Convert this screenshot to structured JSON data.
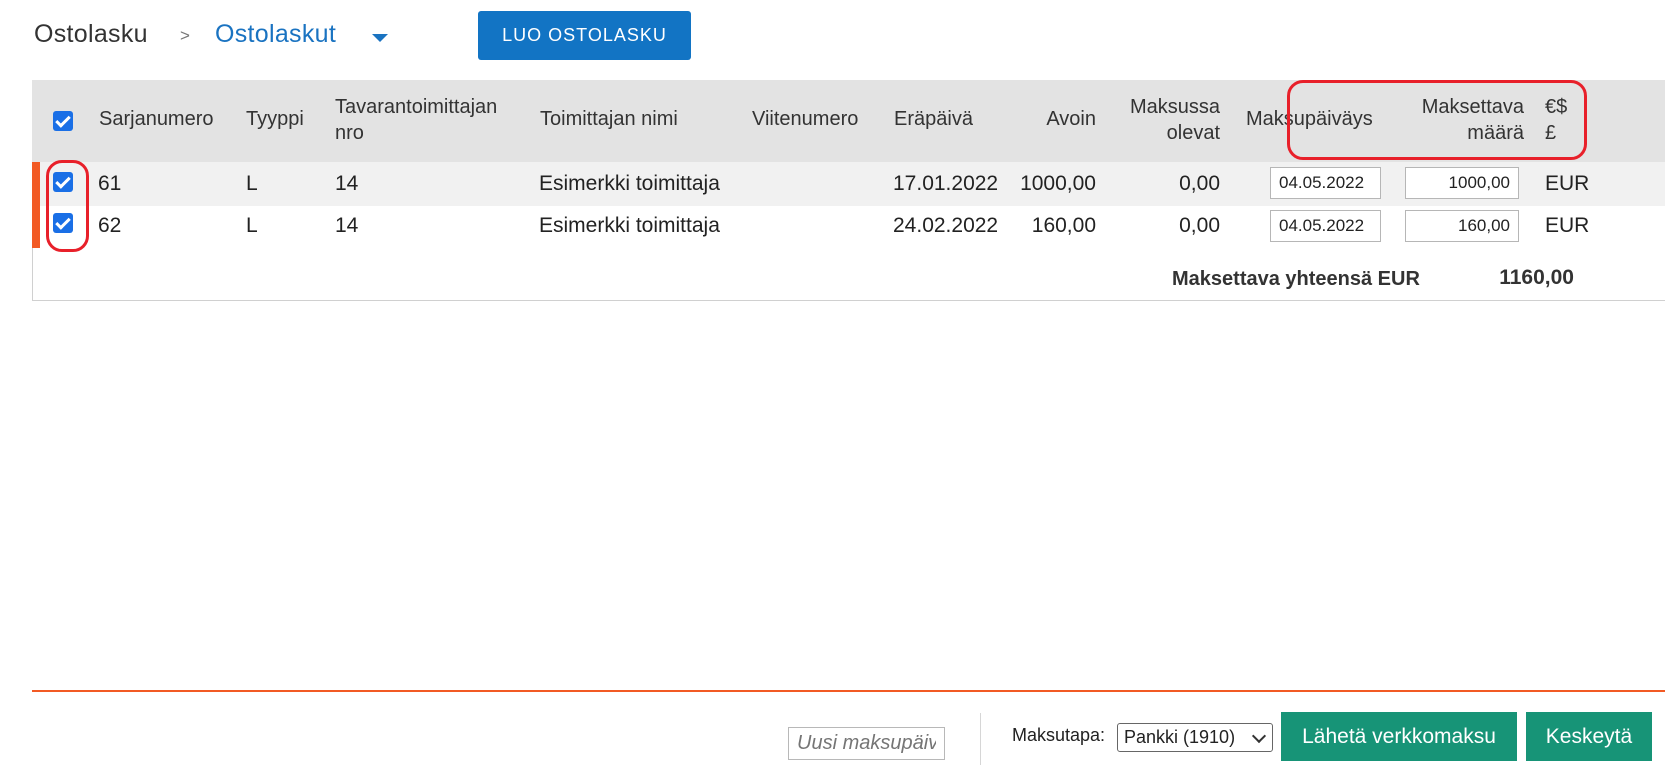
{
  "breadcrumb": {
    "root": "Ostolasku",
    "separator": ">",
    "current": "Ostolaskut"
  },
  "create_button": "LUO OSTOLASKU",
  "table": {
    "headers": {
      "serial": "Sarjanumero",
      "type": "Tyyppi",
      "supplier_no_1": "Tavarantoimittajan",
      "supplier_no_2": "nro",
      "supplier_name": "Toimittajan nimi",
      "reference": "Viitenumero",
      "due_date": "Eräpäivä",
      "open": "Avoin",
      "in_payment_1": "Maksussa",
      "in_payment_2": "olevat",
      "payment_date": "Maksupäiväys",
      "payable_1": "Maksettava",
      "payable_2": "määrä",
      "currency_1": "€$",
      "currency_2": "£"
    },
    "header_checkbox_checked": true,
    "rows": [
      {
        "checked": true,
        "serial": "61",
        "type": "L",
        "supplier_no": "14",
        "supplier_name": "Esimerkki toimittaja",
        "reference": "",
        "due_date": "17.01.2022",
        "open": "1000,00",
        "in_payment": "0,00",
        "payment_date": "04.05.2022",
        "payable": "1000,00",
        "currency": "EUR"
      },
      {
        "checked": true,
        "serial": "62",
        "type": "L",
        "supplier_no": "14",
        "supplier_name": "Esimerkki toimittaja",
        "reference": "",
        "due_date": "24.02.2022",
        "open": "160,00",
        "in_payment": "0,00",
        "payment_date": "04.05.2022",
        "payable": "160,00",
        "currency": "EUR"
      }
    ],
    "total_label": "Maksettava yhteensä EUR",
    "total_value": "1160,00"
  },
  "footer": {
    "new_payment_date_placeholder": "Uusi maksupäiväys",
    "payment_method_label": "Maksutapa:",
    "payment_method_value": "Pankki (1910)",
    "send_button": "Lähetä verkkomaksu",
    "cancel_button": "Keskeytä"
  },
  "colors": {
    "accent_blue": "#1274c4",
    "action_green": "#179477",
    "highlight_red": "#e8202a",
    "marker_orange": "#f25a24"
  }
}
